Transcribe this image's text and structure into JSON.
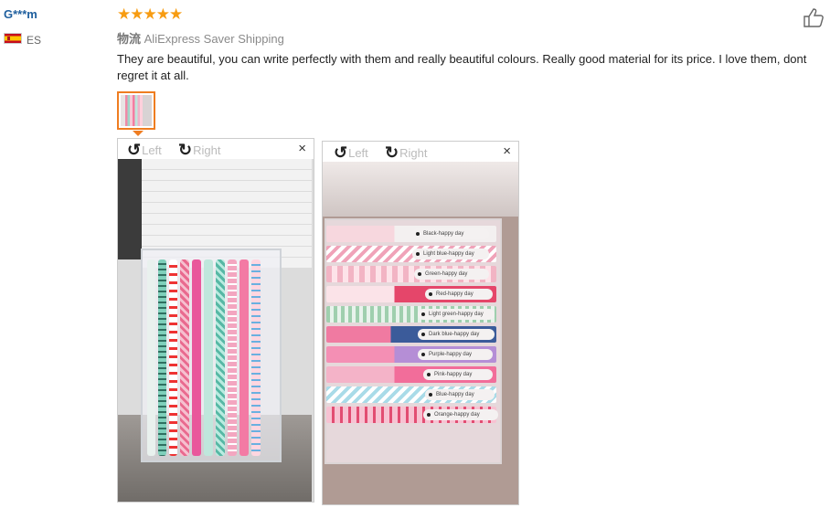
{
  "reviewer": {
    "name": "G***m",
    "country": "ES"
  },
  "rating": {
    "stars": "★★★★★",
    "value": 5
  },
  "shipping": {
    "prefix": "物流",
    "method": "AliExpress Saver Shipping"
  },
  "review": {
    "text": "They are beautiful, you can write perfectly with them and really beautiful colours. Really good material for its price. I love them, dont regret it at all."
  },
  "viewer": {
    "rotate_left": "Left",
    "rotate_right": "Right",
    "close": "×"
  },
  "pen_labels": [
    "Black-happy day",
    "Light blue-happy day",
    "Green-happy day",
    "Red-happy day",
    "Light green-happy day",
    "Dark blue-happy day",
    "Purple-happy day",
    "Pink-happy day",
    "Blue-happy day",
    "Orange-happy day"
  ],
  "icons": {
    "like": "thumbs-up-icon",
    "rotate_left": "rotate-left-icon",
    "rotate_right": "rotate-right-icon",
    "close": "close-icon"
  },
  "colors": {
    "star": "#f79c12",
    "name": "#1f5f9e",
    "accent": "#ef7d21"
  }
}
